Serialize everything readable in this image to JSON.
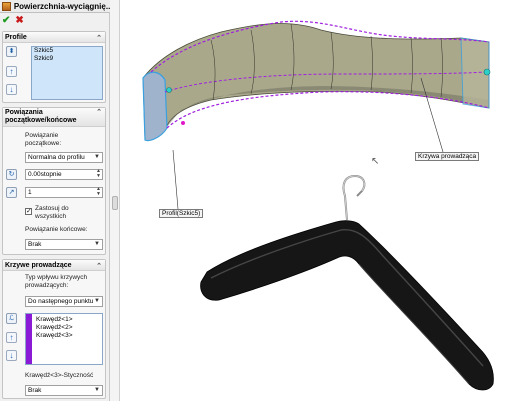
{
  "window": {
    "title": "Powierzchnia-wyciągnię..."
  },
  "actions": {
    "ok": "✔",
    "cancel": "✖"
  },
  "profile": {
    "header": "Profile",
    "items": [
      "Szkic5",
      "Szkic9"
    ]
  },
  "relations": {
    "header": "Powiązania początkowe/końcowe",
    "start_label": "Powiązanie początkowe:",
    "start_value": "Normalna do profilu",
    "angle_value": "0.00stopnie",
    "length_value": "1",
    "apply_all_label": "Zastosuj do wszystkich",
    "end_label": "Powiązanie końcowe:",
    "end_value": "Brak"
  },
  "guides": {
    "header": "Krzywe prowadzące",
    "influence_label": "Typ wpływu krzywych prowadzących:",
    "influence_value": "Do następnego punktu",
    "items": [
      "Krawędź<1>",
      "Krawędź<2>",
      "Krawędź<3>"
    ],
    "tangency_label": "Krawędź<3>-Styczność",
    "tangency_value": "Brak"
  },
  "viewport": {
    "guide_callout": "Krzywa prowadząca",
    "profile_callout": "Profil(Szkic5)"
  },
  "colors": {
    "surface": "#a6a58a",
    "guide_curve": "#a020e0",
    "profile_edge": "#3aa0e0",
    "hanger": "#141414"
  }
}
